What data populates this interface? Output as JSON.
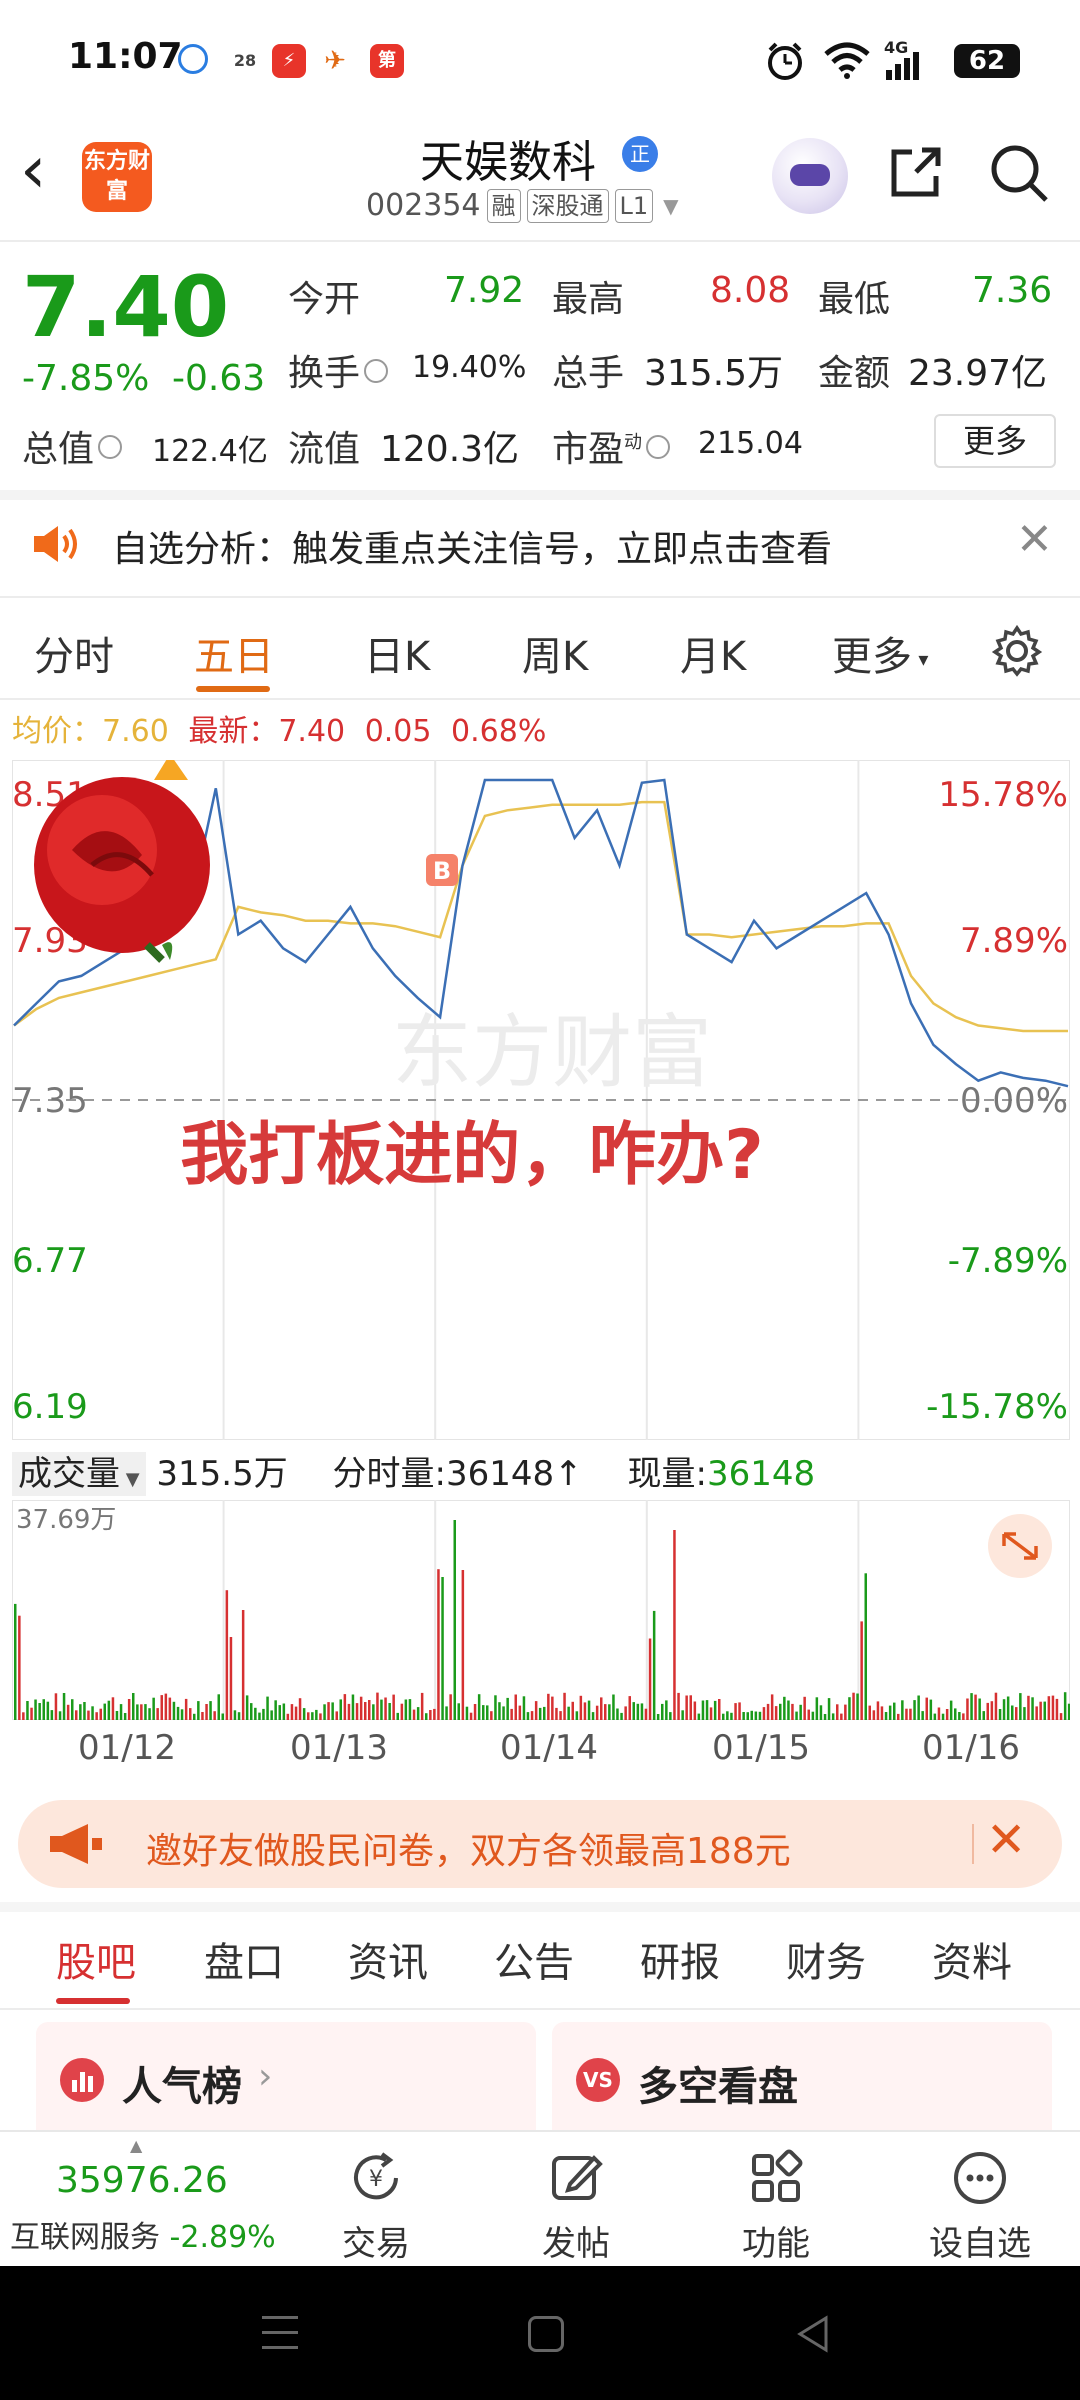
{
  "status_bar": {
    "time": "11:07",
    "notif_badge": "28",
    "app_icon_text": "第",
    "network": "4G",
    "battery": "62"
  },
  "header": {
    "logo_text": "东方财富",
    "stock_name": "天娱数科",
    "badge": "正",
    "code": "002354",
    "tags": [
      "融",
      "深股通",
      "L1"
    ]
  },
  "quote": {
    "price": "7.40",
    "change_pct": "-7.85%",
    "change": "-0.63",
    "open_label": "今开",
    "open": "7.92",
    "high_label": "最高",
    "high": "8.08",
    "low_label": "最低",
    "low": "7.36",
    "turnover_label": "换手",
    "turnover": "19.40%",
    "volume_label": "总手",
    "volume": "315.5万",
    "amount_label": "金额",
    "amount": "23.97亿",
    "mktcap_label": "总值",
    "mktcap": "122.4亿",
    "float_label": "流值",
    "float": "120.3亿",
    "pe_label": "市盈",
    "pe_sup": "动",
    "pe": "215.04",
    "more": "更多"
  },
  "notice": {
    "text": "自选分析：触发重点关注信号，立即点击查看"
  },
  "chart_tabs": [
    "分时",
    "五日",
    "日K",
    "周K",
    "月K",
    "更多"
  ],
  "chart_tab_active": 1,
  "avg_row": {
    "avg_label": "均价：",
    "avg": "7.60",
    "latest_label": "最新：",
    "latest": "7.40",
    "change": "0.05",
    "pct": "0.68%"
  },
  "chart_data": {
    "type": "line",
    "ylabels_left": [
      "8.51",
      "7.93",
      "7.35",
      "6.77",
      "6.19"
    ],
    "ylabels_right": [
      "15.78%",
      "7.89%",
      "0.00%",
      "-7.89%",
      "-15.78%"
    ],
    "x_dates": [
      "01/12",
      "01/13",
      "01/14",
      "01/15",
      "01/16"
    ],
    "ylim": [
      6.19,
      8.51
    ],
    "prev_close": 7.35,
    "series": [
      {
        "values": [
          7.62,
          7.7,
          7.78,
          7.8,
          7.85,
          7.9,
          7.95,
          8.0,
          8.1,
          8.48,
          7.95,
          8.0,
          7.9,
          7.85,
          7.95,
          8.05,
          7.9,
          7.8,
          7.72,
          7.65,
          8.2,
          8.51,
          8.51,
          8.51,
          8.51,
          8.3,
          8.4,
          8.2,
          8.5,
          8.51,
          7.95,
          7.9,
          7.85,
          8.0,
          7.9,
          7.95,
          8.0,
          8.05,
          8.1,
          7.95,
          7.7,
          7.55,
          7.48,
          7.42,
          7.45,
          7.43,
          7.42,
          7.4
        ]
      },
      {
        "values": [
          7.62,
          7.68,
          7.72,
          7.74,
          7.76,
          7.78,
          7.8,
          7.82,
          7.84,
          7.86,
          8.05,
          8.03,
          8.02,
          8.0,
          8.0,
          7.99,
          7.99,
          7.98,
          7.96,
          7.94,
          8.2,
          8.38,
          8.4,
          8.41,
          8.42,
          8.42,
          8.42,
          8.42,
          8.43,
          8.43,
          7.95,
          7.95,
          7.94,
          7.95,
          7.96,
          7.97,
          7.98,
          7.98,
          7.99,
          7.99,
          7.8,
          7.7,
          7.65,
          7.62,
          7.61,
          7.6,
          7.6,
          7.6
        ]
      }
    ],
    "colors": {
      "price": "#3b6fb5",
      "avg": "#e8c252"
    },
    "watermark": "东方财富"
  },
  "overlay": {
    "caption": "我打板进的，咋办?",
    "marker": "B"
  },
  "volume": {
    "label": "成交量",
    "total": "315.5万",
    "tick_label": "分时量:36148↑",
    "now_label": "现量:",
    "now": "36148",
    "max": "37.69万"
  },
  "banner": {
    "text": "邀好友做股民问卷，双方各领最高188元"
  },
  "info_tabs": [
    "股吧",
    "盘口",
    "资讯",
    "公告",
    "研报",
    "财务",
    "资料"
  ],
  "cards": [
    {
      "title": "人气榜"
    },
    {
      "title": "多空看盘"
    }
  ],
  "bottom_nav": {
    "index_value": "35976.26",
    "index_name": "互联网服务",
    "index_change": "-2.89%",
    "items": [
      "交易",
      "发帖",
      "功能",
      "设自选"
    ]
  }
}
